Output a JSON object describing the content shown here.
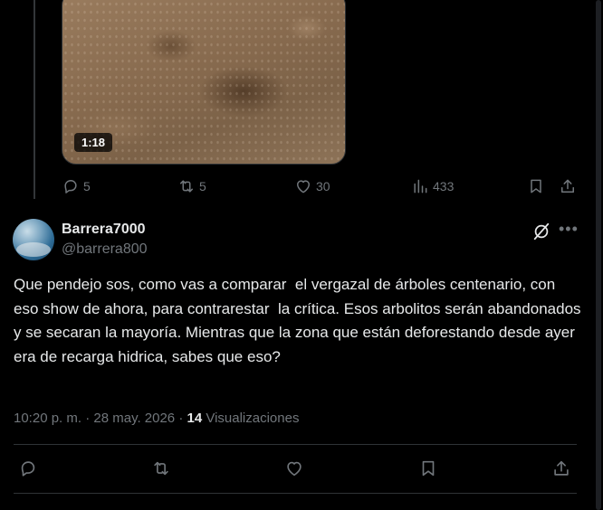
{
  "previous_tweet": {
    "video_duration": "1:18",
    "replies": "5",
    "reposts": "5",
    "likes": "30",
    "views": "433",
    "icons": [
      "reply-icon",
      "repost-icon",
      "like-icon",
      "views-icon",
      "bookmark-icon",
      "share-icon"
    ]
  },
  "tweet": {
    "display_name": "Barrera7000",
    "handle": "@barrera800",
    "text": "Que pendejo sos, como vas a comparar  el vergazal de árboles centenario, con eso show de ahora, para contrarestar  la crítica. Esos arbolitos serán abandonados y se secaran la mayoría. Mientras que la zona que están deforestando desde ayer  era de recarga hidrica, sabes que eso?",
    "timestamp": "10:20 p. m. · 28 may. 2026 · ",
    "views_count": "14",
    "views_label": "Visualizaciones"
  },
  "colors": {
    "background": "#000000",
    "text": "#e7e9ea",
    "muted": "#71767b",
    "divider": "#2f3336"
  }
}
